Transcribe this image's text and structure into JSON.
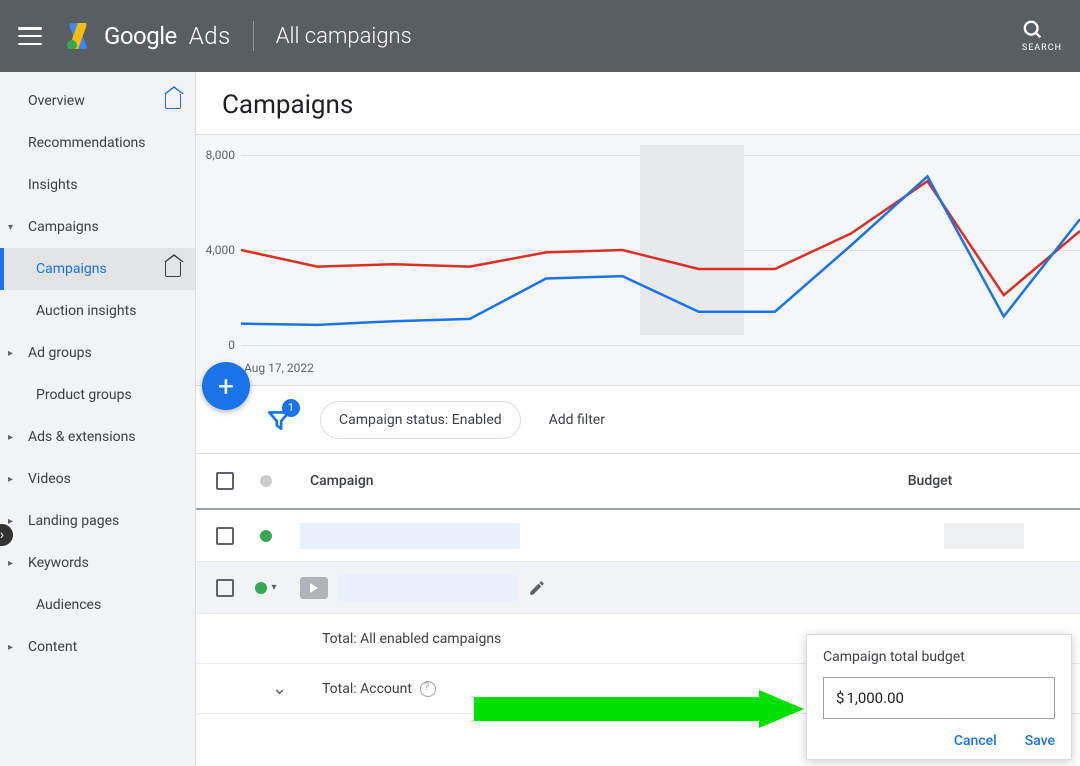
{
  "header": {
    "brand1": "Google",
    "brand2": "Ads",
    "title": "All campaigns",
    "search_label": "SEARCH"
  },
  "sidebar": {
    "items": [
      {
        "label": "Overview",
        "caret": "",
        "home": "blue"
      },
      {
        "label": "Recommendations",
        "caret": ""
      },
      {
        "label": "Insights",
        "caret": ""
      },
      {
        "label": "Campaigns",
        "caret": "▾"
      },
      {
        "label": "Campaigns",
        "caret": "",
        "active": true,
        "home": "dark"
      },
      {
        "label": "Auction insights",
        "caret": ""
      },
      {
        "label": "Ad groups",
        "caret": "▸"
      },
      {
        "label": "Product groups",
        "caret": ""
      },
      {
        "label": "Ads & extensions",
        "caret": "▸"
      },
      {
        "label": "Videos",
        "caret": "▸"
      },
      {
        "label": "Landing pages",
        "caret": "▸"
      },
      {
        "label": "Keywords",
        "caret": "▸"
      },
      {
        "label": "Audiences",
        "caret": ""
      },
      {
        "label": "Content",
        "caret": "▸"
      }
    ]
  },
  "page": {
    "title": "Campaigns"
  },
  "chart_data": {
    "type": "line",
    "ylim": [
      0,
      8000
    ],
    "yticks": [
      0,
      4000,
      8000
    ],
    "ytick_labels": [
      "0",
      "4,000",
      "8,000"
    ],
    "x_start_label": "Aug 17, 2022",
    "shaded_band": [
      0.475,
      0.6
    ],
    "series": [
      {
        "name": "red",
        "color": "#d93025",
        "values": [
          4000,
          3300,
          3400,
          3300,
          3900,
          4000,
          3200,
          3200,
          4700,
          6900,
          2100,
          4800
        ]
      },
      {
        "name": "blue",
        "color": "#1a73e8",
        "values": [
          900,
          850,
          1000,
          1100,
          2800,
          2900,
          1400,
          1400,
          4200,
          7100,
          1200,
          5300
        ]
      }
    ]
  },
  "filters": {
    "badge_count": "1",
    "chip": "Campaign status: Enabled",
    "add_filter": "Add filter",
    "fab": "+"
  },
  "table": {
    "columns": {
      "campaign": "Campaign",
      "budget": "Budget"
    },
    "summary_all": "Total: All enabled campaigns",
    "summary_account": "Total: Account"
  },
  "popup": {
    "title": "Campaign total budget",
    "currency": "$",
    "value": "1,000.00",
    "cancel": "Cancel",
    "save": "Save"
  }
}
